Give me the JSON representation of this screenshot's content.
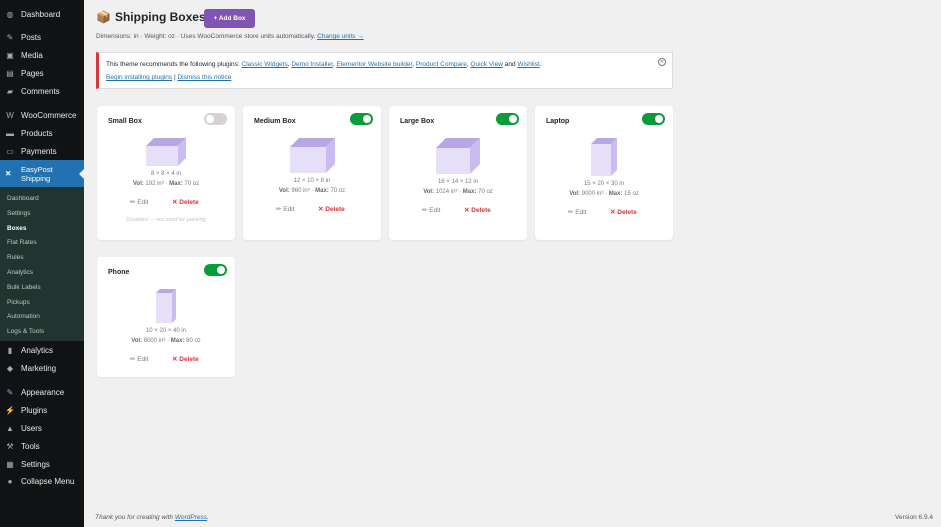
{
  "sidebar": {
    "items": [
      {
        "label": "Dashboard",
        "icon": "dashboard-icon",
        "glyph": "◍"
      },
      {
        "label": "Posts",
        "icon": "pin-icon",
        "glyph": "✎"
      },
      {
        "label": "Media",
        "icon": "media-icon",
        "glyph": "▣"
      },
      {
        "label": "Pages",
        "icon": "pages-icon",
        "glyph": "▤"
      },
      {
        "label": "Comments",
        "icon": "comment-icon",
        "glyph": "▰"
      },
      {
        "label": "WooCommerce",
        "icon": "woo-icon",
        "glyph": "W"
      },
      {
        "label": "Products",
        "icon": "products-icon",
        "glyph": "▬"
      },
      {
        "label": "Payments",
        "icon": "payments-icon",
        "glyph": "▭"
      },
      {
        "label": "Analytics",
        "icon": "analytics-icon",
        "glyph": "▮"
      },
      {
        "label": "Marketing",
        "icon": "megaphone-icon",
        "glyph": "◆"
      },
      {
        "label": "Appearance",
        "icon": "brush-icon",
        "glyph": "✎"
      },
      {
        "label": "Plugins",
        "icon": "plugin-icon",
        "glyph": "⚡"
      },
      {
        "label": "Users",
        "icon": "user-icon",
        "glyph": "▲"
      },
      {
        "label": "Tools",
        "icon": "wrench-icon",
        "glyph": "⚒"
      },
      {
        "label": "Settings",
        "icon": "settings-icon",
        "glyph": "▦"
      },
      {
        "label": "Collapse Menu",
        "icon": "collapse-icon",
        "glyph": "●"
      }
    ],
    "active": {
      "label1": "EasyPost",
      "label2": "Shipping"
    },
    "submenu": [
      "Dashboard",
      "Settings",
      "Boxes",
      "Flat Rates",
      "Rules",
      "Analytics",
      "Bulk Labels",
      "Pickups",
      "Automation",
      "Logs & Tools"
    ]
  },
  "header": {
    "title": "Shipping Boxes",
    "add_label": "+ Add Box",
    "units_text": "Dimensions: in · Weight: oz · Uses WooCommerce store units automatically.",
    "units_link": "Change units →"
  },
  "notice": {
    "text": "This theme recommends the following plugins:",
    "plugins": [
      "Classic Widgets",
      "Demo Installer",
      "Elementor Website builder",
      "Product Compare",
      "Quick View",
      "Wishlist"
    ],
    "and": "and",
    "begin": "Begin installing plugins",
    "sep": "|",
    "dismiss": "Dismiss this notice"
  },
  "boxes": [
    {
      "name": "Small Box",
      "enabled": false,
      "dims": "8 × 8 × 4 in",
      "vol_label": "Vol:",
      "vol": "192 in³",
      "max_label": "Max:",
      "max": "70 oz",
      "disabled_text": "Disabled — not used for packing"
    },
    {
      "name": "Medium Box",
      "enabled": true,
      "dims": "12 × 10 × 8 in",
      "vol_label": "Vol:",
      "vol": "960 in³",
      "max_label": "Max:",
      "max": "70 oz"
    },
    {
      "name": "Large Box",
      "enabled": true,
      "dims": "16 × 14 × 12 in",
      "vol_label": "Vol:",
      "vol": "1024 in³",
      "max_label": "Max:",
      "max": "70 oz"
    },
    {
      "name": "Laptop",
      "enabled": true,
      "dims": "15 × 20 × 30 in",
      "vol_label": "Vol:",
      "vol": "9000 in³",
      "max_label": "Max:",
      "max": "15 oz"
    },
    {
      "name": "Phone",
      "enabled": true,
      "dims": "10 × 20 × 40 in",
      "vol_label": "Vol:",
      "vol": "8000 in³",
      "max_label": "Max:",
      "max": "80 oz"
    }
  ],
  "actions": {
    "edit": "✏ Edit",
    "delete": "✕ Delete"
  },
  "footer": {
    "text": "Thank you for creating with",
    "link": "WordPress",
    "version": "Version 6.9.4"
  }
}
